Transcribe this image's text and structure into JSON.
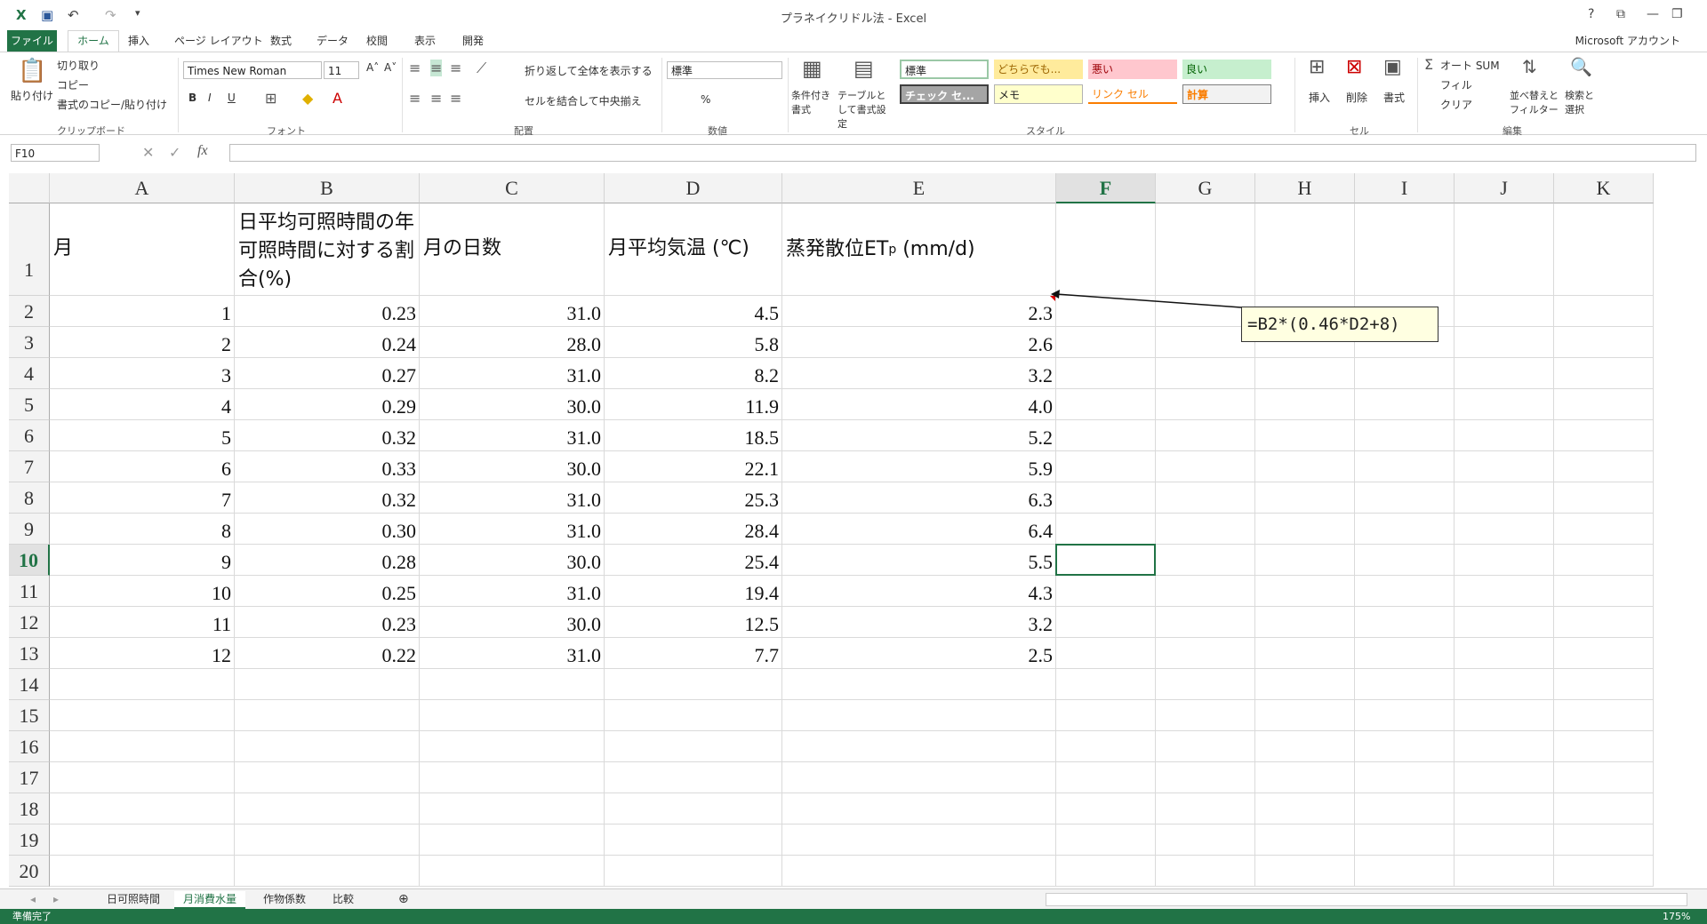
{
  "window": {
    "title": "プラネイクリドル法 - Excel",
    "account": "Microsoft アカウント"
  },
  "tabs": [
    "ファイル",
    "ホーム",
    "挿入",
    "ページ レイアウト",
    "数式",
    "データ",
    "校閲",
    "表示",
    "開発"
  ],
  "ribbon": {
    "clipboard": {
      "paste": "貼り付け",
      "cut": "切り取り",
      "copy": "コピー",
      "format_painter": "書式のコピー/貼り付け",
      "group": "クリップボード"
    },
    "font": {
      "name": "Times New Roman",
      "size": "11",
      "group": "フォント",
      "bold": "B",
      "italic": "I",
      "underline": "U"
    },
    "alignment": {
      "wrap": "折り返して全体を表示する",
      "merge": "セルを結合して中央揃え",
      "group": "配置"
    },
    "number": {
      "format": "標準",
      "percent": "%",
      "group": "数値"
    },
    "styles": {
      "conditional": "条件付き書式",
      "table": "テーブルとして書式設定",
      "cells": [
        {
          "label": "標準",
          "bg": "#ffffff",
          "fg": "#000000"
        },
        {
          "label": "どちらでも...",
          "bg": "#ffeb9c",
          "fg": "#9c6500"
        },
        {
          "label": "悪い",
          "bg": "#ffc7ce",
          "fg": "#9c0006"
        },
        {
          "label": "良い",
          "bg": "#c6efce",
          "fg": "#006100"
        },
        {
          "label": "チェック セ...",
          "bg": "#a5a5a5",
          "fg": "#ffffff"
        },
        {
          "label": "メモ",
          "bg": "#ffffcc",
          "fg": "#000000"
        },
        {
          "label": "リンク セル",
          "bg": "#ffffff",
          "fg": "#fa7d00"
        },
        {
          "label": "計算",
          "bg": "#f2f2f2",
          "fg": "#fa7d00"
        }
      ],
      "group": "スタイル"
    },
    "cells": {
      "insert": "挿入",
      "delete": "削除",
      "format": "書式",
      "group": "セル"
    },
    "editing": {
      "autosum": "オート SUM",
      "fill": "フィル",
      "clear": "クリア",
      "sort": "並べ替えとフィルター",
      "find": "検索と選択",
      "group": "編集"
    }
  },
  "formula_bar": {
    "name_box": "F10",
    "formula": ""
  },
  "columns": [
    "A",
    "B",
    "C",
    "D",
    "E",
    "F",
    "G",
    "H",
    "I",
    "J",
    "K"
  ],
  "header_row": {
    "A": "月",
    "B": "日平均可照時間の年可照時間に対する割合(%)",
    "C": "月の日数",
    "D": "月平均気温 (℃)",
    "E_main": "蒸発散位ET",
    "E_sub": "p",
    "E_unit": " (mm/d)"
  },
  "rows": [
    [
      "1",
      "0.23",
      "31.0",
      "4.5",
      "2.3"
    ],
    [
      "2",
      "0.24",
      "28.0",
      "5.8",
      "2.6"
    ],
    [
      "3",
      "0.27",
      "31.0",
      "8.2",
      "3.2"
    ],
    [
      "4",
      "0.29",
      "30.0",
      "11.9",
      "4.0"
    ],
    [
      "5",
      "0.32",
      "31.0",
      "18.5",
      "5.2"
    ],
    [
      "6",
      "0.33",
      "30.0",
      "22.1",
      "5.9"
    ],
    [
      "7",
      "0.32",
      "31.0",
      "25.3",
      "6.3"
    ],
    [
      "8",
      "0.30",
      "31.0",
      "28.4",
      "6.4"
    ],
    [
      "9",
      "0.28",
      "30.0",
      "25.4",
      "5.5"
    ],
    [
      "10",
      "0.25",
      "31.0",
      "19.4",
      "4.3"
    ],
    [
      "11",
      "0.23",
      "30.0",
      "12.5",
      "3.2"
    ],
    [
      "12",
      "0.22",
      "31.0",
      "7.7",
      "2.5"
    ]
  ],
  "row_numbers": [
    "1",
    "2",
    "3",
    "4",
    "5",
    "6",
    "7",
    "8",
    "9",
    "10",
    "11",
    "12",
    "13",
    "14",
    "15",
    "16",
    "17",
    "18",
    "19",
    "20"
  ],
  "callout": "=B2*(0.46*D2+8)",
  "sheets": [
    {
      "label": "日可照時間",
      "active": false
    },
    {
      "label": "月消費水量",
      "active": true
    },
    {
      "label": "作物係数",
      "active": false
    },
    {
      "label": "比較",
      "active": false
    }
  ],
  "status": {
    "ready": "準備完了",
    "zoom": "175%"
  },
  "accent": "#217346"
}
